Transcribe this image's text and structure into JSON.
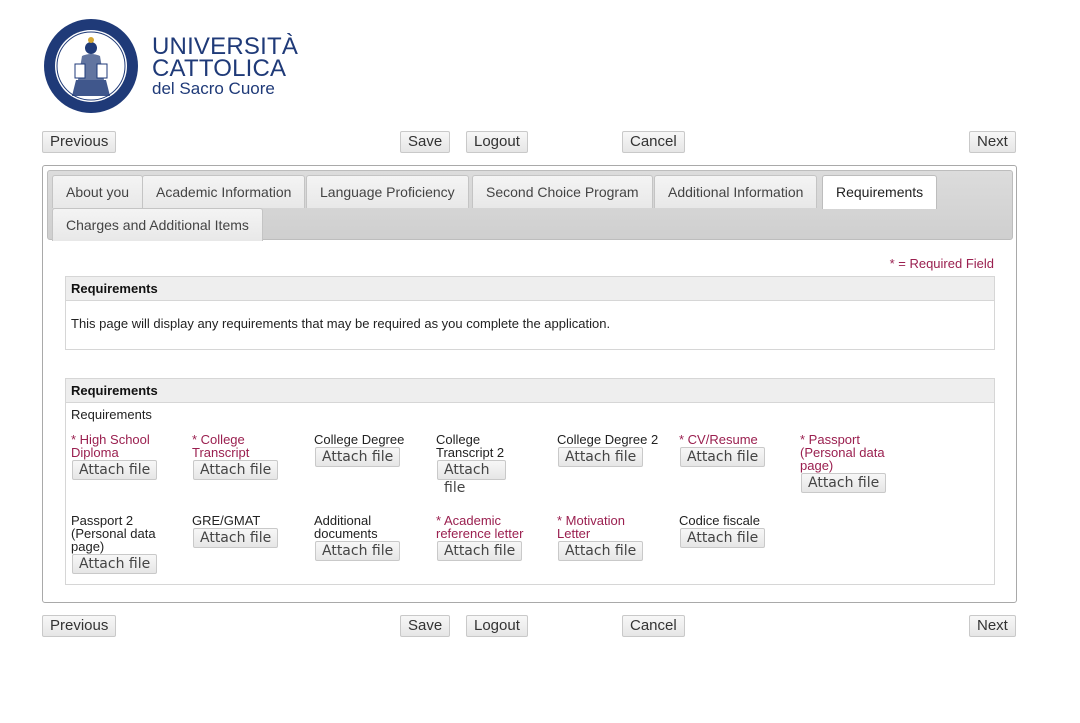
{
  "logo": {
    "line1": "UNIVERSITÀ",
    "line2": "CATTOLICA",
    "line3": "del Sacro Cuore"
  },
  "nav": {
    "previous": "Previous",
    "save": "Save",
    "logout": "Logout",
    "cancel": "Cancel",
    "next": "Next"
  },
  "tabs": [
    {
      "label": "About you"
    },
    {
      "label": "Academic Information"
    },
    {
      "label": "Language Proficiency"
    },
    {
      "label": "Second Choice Program"
    },
    {
      "label": "Additional Information"
    },
    {
      "label": "Requirements",
      "active": true
    },
    {
      "label": "Charges and Additional Items"
    }
  ],
  "required_note": "* = Required Field",
  "intro_section": {
    "title": "Requirements",
    "text": "This page will display any requirements that may be required as you complete the application."
  },
  "requirements_section": {
    "title": "Requirements",
    "subtitle": "Requirements",
    "attach_label": "Attach file",
    "items": [
      {
        "label": "* High School Diploma",
        "required": true
      },
      {
        "label": "* College Transcript",
        "required": true
      },
      {
        "label": "College Degree",
        "required": false
      },
      {
        "label": "College Transcript 2",
        "required": false
      },
      {
        "label": "College Degree 2",
        "required": false
      },
      {
        "label": "* CV/Resume",
        "required": true
      },
      {
        "label": "* Passport (Personal data page)",
        "required": true
      },
      {
        "label": "Passport 2 (Personal data page)",
        "required": false
      },
      {
        "label": "GRE/GMAT",
        "required": false
      },
      {
        "label": "Additional documents",
        "required": false
      },
      {
        "label": "* Academic reference letter",
        "required": true
      },
      {
        "label": "* Motivation Letter",
        "required": true
      },
      {
        "label": "Codice fiscale",
        "required": false
      }
    ]
  },
  "colors": {
    "brand_blue": "#1f3a78",
    "required_red": "#9a1f4f"
  }
}
